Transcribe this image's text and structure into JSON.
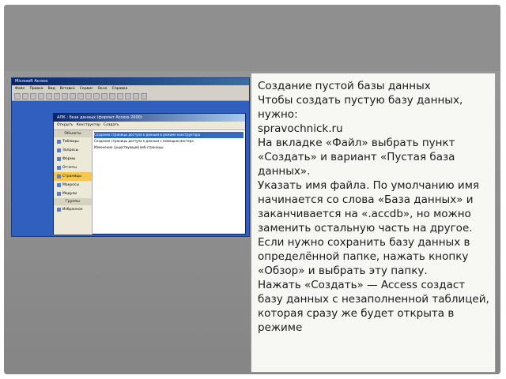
{
  "screenshot": {
    "app_title": "Microsoft Access",
    "menu": [
      "Файл",
      "Правка",
      "Вид",
      "Вставка",
      "Сервис",
      "Окно",
      "Справка"
    ],
    "db_window_title": "АЛК : база данных (формат Access 2000)",
    "db_toolbar": [
      "Открыть",
      "Конструктор",
      "Создать"
    ],
    "sidebar_header": "Объекты",
    "sidebar_items": [
      "Таблицы",
      "Запросы",
      "Формы",
      "Отчеты",
      "Страницы",
      "Макросы",
      "Модули"
    ],
    "sidebar_selected": "Страницы",
    "groups_header": "Группы",
    "groups_item": "Избранное",
    "list_items": [
      "Создание страницы доступа к данным в режиме конструктора",
      "Создание страницы доступа к данным с помощью мастера",
      "Изменение существующей веб-страницы"
    ]
  },
  "text": {
    "line1": "Создание пустой базы данных",
    "para1": "Чтобы создать пустую базу данных, нужно:",
    "source": "spravochnick.ru",
    "para2": "На вкладке «Файл» выбрать пункт «Создать» и вариант «Пустая база данных».",
    "para3": "Указать имя файла. По умолчанию имя начинается со слова «База данных» и заканчивается на «.accdb», но можно заменить остальную часть на другое.",
    "para4": "Если нужно сохранить базу данных в определённой папке, нажать кнопку «Обзор» и выбрать эту папку.",
    "para5": "Нажать «Создать» — Access создаст базу данных с незаполненной таблицей, которая сразу же будет открыта в режиме"
  }
}
